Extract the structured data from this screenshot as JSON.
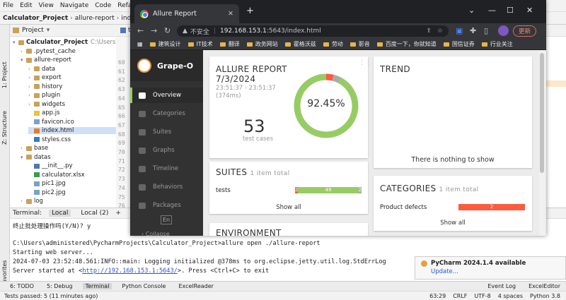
{
  "ide": {
    "menu": [
      "File",
      "Edit",
      "View",
      "Navigate",
      "Code",
      "Refactor"
    ],
    "breadcrumb": [
      "Calculator_Project",
      "allure-report",
      "index.html"
    ],
    "editor_tab": "test_ac",
    "left_strip": [
      "1: Project",
      "Z: Structure",
      "2: Favorites"
    ],
    "project_panel": {
      "title": "Project",
      "tree": [
        {
          "label": "Calculator_Project",
          "note": "C:\\Users\\a",
          "type": "fold",
          "bold": true
        },
        {
          "label": ".pytest_cache",
          "type": "fold"
        },
        {
          "label": "allure-report",
          "type": "fold"
        },
        {
          "label": "data",
          "type": "fold"
        },
        {
          "label": "export",
          "type": "fold"
        },
        {
          "label": "history",
          "type": "fold"
        },
        {
          "label": "plugin",
          "type": "fold"
        },
        {
          "label": "widgets",
          "type": "fold"
        },
        {
          "label": "app.js",
          "type": "fjs"
        },
        {
          "label": "favicon.ico",
          "type": "fimg"
        },
        {
          "label": "index.html",
          "type": "fhtml",
          "selected": true
        },
        {
          "label": "styles.css",
          "type": "fcss"
        },
        {
          "label": "base",
          "type": "fold"
        },
        {
          "label": "datas",
          "type": "fold"
        },
        {
          "label": "__init__.py",
          "type": "fpy"
        },
        {
          "label": "calculator.xlsx",
          "type": "fxls"
        },
        {
          "label": "pic1.jpg",
          "type": "fimg"
        },
        {
          "label": "pic2.jpg",
          "type": "fimg"
        },
        {
          "label": "log",
          "type": "fold"
        }
      ]
    },
    "line_numbers": [
      "60",
      "61",
      "62",
      "63",
      "64",
      "65",
      "66",
      "67",
      "68",
      "69",
      "70",
      "71",
      "72",
      "73",
      "74",
      "75",
      "76",
      "77"
    ],
    "terminal": {
      "label": "Terminal:",
      "tabs": [
        "Local",
        "Local (2)"
      ],
      "add": "+",
      "lines": [
        "终止批处理操作吗(Y/N)? y",
        "",
        "C:\\Users\\administered\\PycharmProjects\\Calculator_Project>allure open ./allure-report",
        "Starting web server...",
        "2024-07-03 23:52:48.561:INFO::main: Logging initialized @378ms to org.eclipse.jetty.util.log.StdErrLog"
      ],
      "server_prefix": "Server started at <",
      "server_url": "http://192.168.153.1:5643/",
      "server_suffix": ">. Press <Ctrl+C> to exit"
    },
    "bottom_tabs": [
      "6: TODO",
      "5: Debug",
      "Terminal",
      "Python Console",
      "ExcelReader"
    ],
    "bottom_right": [
      "Event Log",
      "ExcelEditor"
    ],
    "status_left": "Tests passed: 5 (11 minutes ago)",
    "status_right": [
      "63:29",
      "CRLF",
      "UTF-8",
      "4 spaces",
      "Python 3.8"
    ],
    "notification": {
      "title": "PyCharm 2024.1.4 available",
      "link": "Update..."
    }
  },
  "browser": {
    "tab_title": "Allure Report",
    "new_tab": "+",
    "not_secure": "不安全",
    "url_host": "192.168.153.1",
    "url_rest": ":5643/index.html",
    "update_button": "更新",
    "bookmarks": [
      "建筑设计",
      "IT技术",
      "翻译",
      "政务网站",
      "霍格沃兹",
      "劳动",
      "影音",
      "百度一下，你就知道",
      "国信证券",
      "行业关注"
    ]
  },
  "allure": {
    "brand": "Grape-O",
    "nav": [
      "Overview",
      "Categories",
      "Suites",
      "Graphs",
      "Timeline",
      "Behaviors",
      "Packages"
    ],
    "lang": "En",
    "collapse": "Collapse",
    "summary": {
      "heading": "ALLURE REPORT",
      "date": "7/3/2024",
      "time": "23:51:37 - 23:51:37",
      "duration": "(374ms)",
      "count": "53",
      "count_label": "test cases",
      "percent": "92.45%",
      "passed": 49,
      "failed": 2,
      "broken": 2
    },
    "trend": {
      "heading": "TREND",
      "empty": "There is nothing to show"
    },
    "suites": {
      "heading": "SUITES",
      "sub": "1 item total",
      "row_name": "tests",
      "failed": "2",
      "passed": "49",
      "broken": "2",
      "show_all": "Show all"
    },
    "categories": {
      "heading": "CATEGORIES",
      "sub": "1 item total",
      "row_name": "Product defects",
      "count": "2",
      "show_all": "Show all"
    },
    "environment": {
      "heading": "ENVIRONMENT"
    }
  },
  "colors": {
    "passed": "#97cc64",
    "failed": "#fd5a3e",
    "broken": "#ffd050",
    "skipped": "#aaaaaa",
    "accent": "#97cc64"
  }
}
